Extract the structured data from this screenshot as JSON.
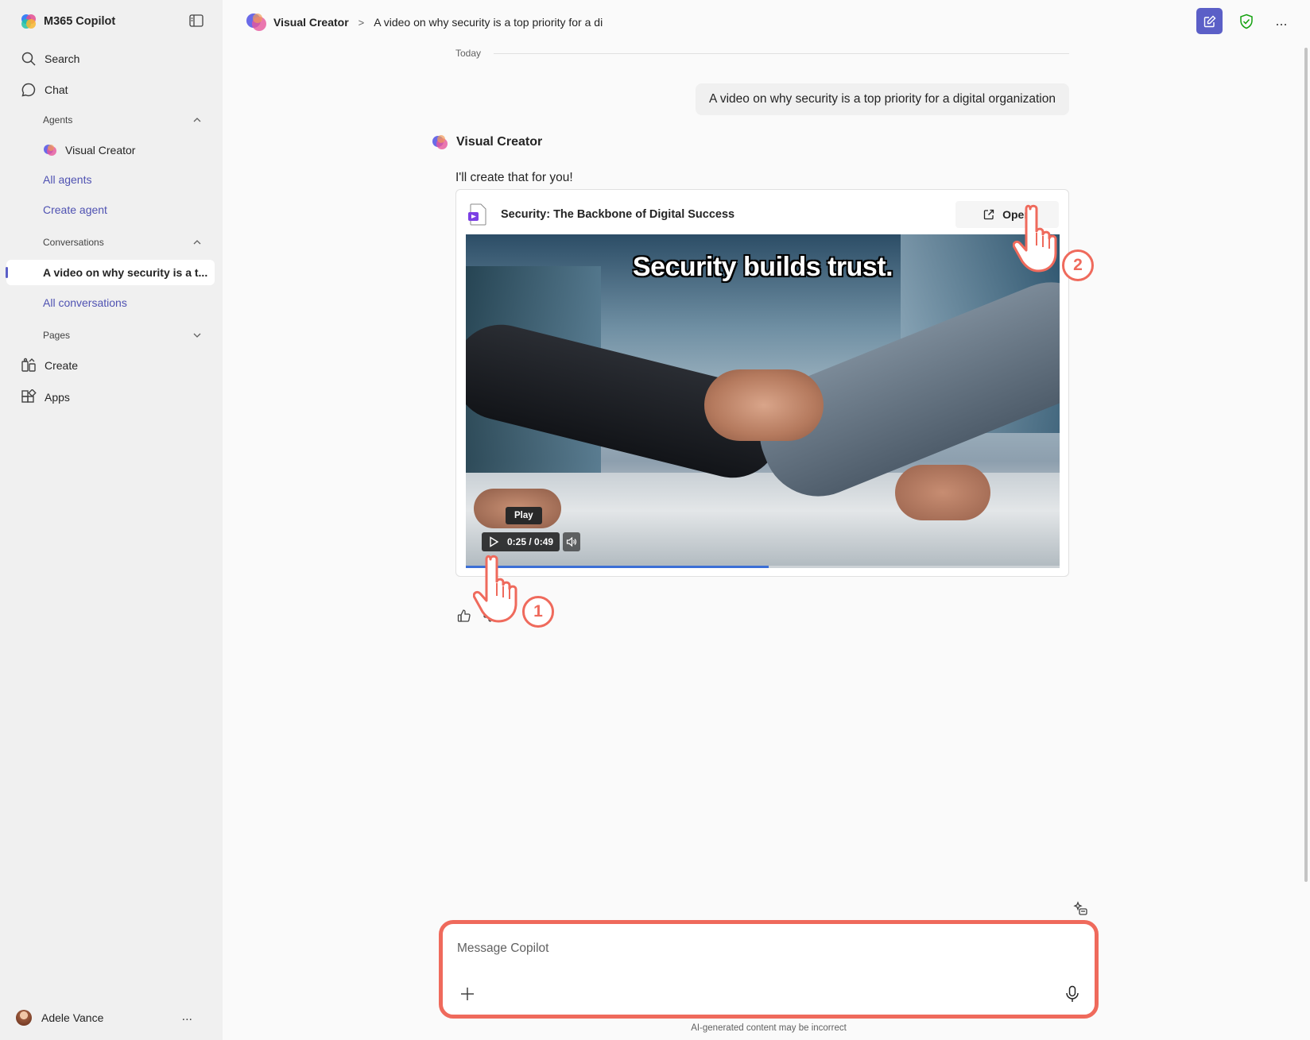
{
  "sidebar": {
    "app_title": "M365 Copilot",
    "search_label": "Search",
    "chat_label": "Chat",
    "agents_section": "Agents",
    "agent_item": "Visual Creator",
    "all_agents": "All agents",
    "create_agent": "Create agent",
    "conversations_section": "Conversations",
    "active_conversation": "A video on why security is a t...",
    "all_conversations": "All conversations",
    "pages_section": "Pages",
    "create_label": "Create",
    "apps_label": "Apps",
    "user_name": "Adele Vance",
    "user_more": "..."
  },
  "header": {
    "agent_name": "Visual Creator",
    "separator": ">",
    "conversation_title": "A video on why security is a top priority for a di",
    "more": "..."
  },
  "chat": {
    "date_divider": "Today",
    "user_message": "A video on why security is a top priority for a digital organization",
    "bot_name": "Visual Creator",
    "bot_reply": "I'll create that for you!",
    "card": {
      "title": "Security: The Backbone of Digital Success",
      "open_label": "Open",
      "video_caption": "Security builds trust.",
      "tooltip": "Play",
      "time_display": "0:25 / 0:49",
      "progress_fraction": 0.51
    }
  },
  "annotations": {
    "step1": "1",
    "step2": "2"
  },
  "composer": {
    "placeholder": "Message Copilot",
    "disclaimer": "AI-generated content may be incorrect"
  },
  "colors": {
    "accent": "#5b5fc7",
    "link": "#4f52b2",
    "annotation": "#ef6a5c"
  }
}
